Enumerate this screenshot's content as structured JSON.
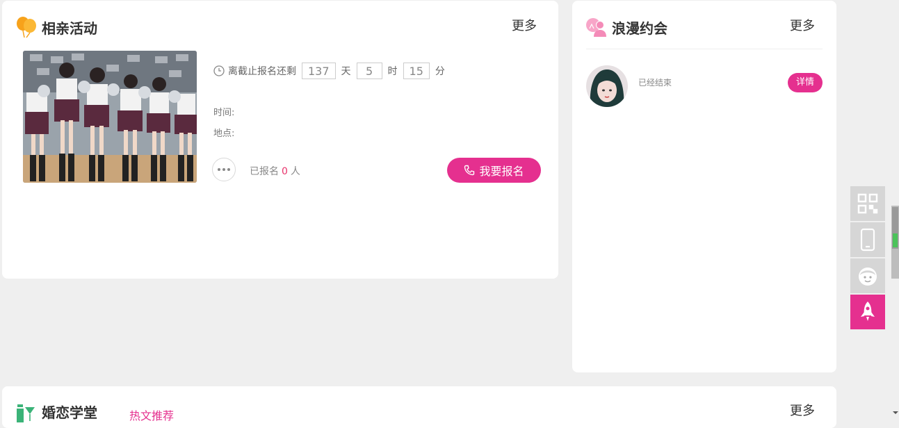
{
  "activity": {
    "title": "相亲活动",
    "more": "更多",
    "countdown_prefix": "离截止报名还剩",
    "days": "137",
    "days_unit": "天",
    "hours": "5",
    "hours_unit": "时",
    "minutes": "15",
    "minutes_unit": "分",
    "time_label": "时间:",
    "place_label": "地点:",
    "signed_prefix": "已报名",
    "signed_count": "0",
    "signed_suffix": "人",
    "signup_button": "我要报名"
  },
  "dating": {
    "title": "浪漫约会",
    "more": "更多",
    "item_status": "已经结束",
    "detail_button": "详情"
  },
  "school": {
    "title": "婚恋学堂",
    "tab_hot": "热文推荐",
    "more": "更多"
  },
  "colors": {
    "accent": "#e5308f",
    "count": "#e8336b",
    "bg": "#efefef"
  },
  "float_bar": [
    "qr-code-icon",
    "mobile-phone-icon",
    "customer-service-icon",
    "rocket-top-icon"
  ]
}
